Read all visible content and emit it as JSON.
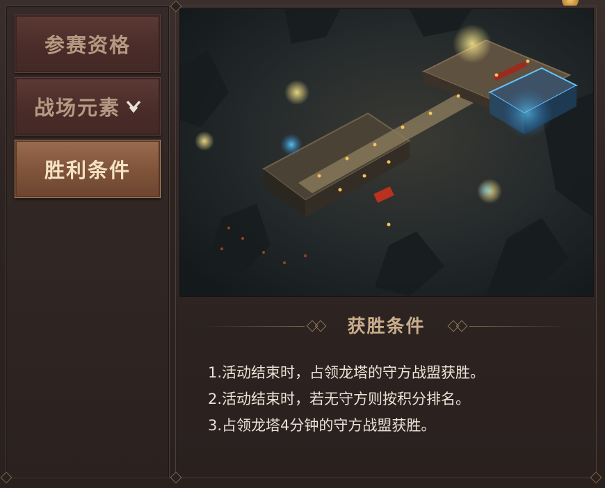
{
  "sidebar": {
    "tabs": [
      {
        "label": "参赛资格",
        "state": "inactive"
      },
      {
        "label": "战场元素",
        "state": "inactive",
        "icon": "chevron-down-double-icon"
      },
      {
        "label": "胜利条件",
        "state": "active"
      }
    ]
  },
  "content": {
    "map_image": "dungeon-castle-battlefield-map",
    "heading": "获胜条件",
    "rules": [
      "1.活动结束时，占领龙塔的守方战盟获胜。",
      "2.活动结束时，若无守方则按积分排名。",
      "3.占领龙塔4分钟的守方战盟获胜。"
    ]
  },
  "colors": {
    "active_tab": "#8a5d42",
    "inactive_tab": "#4a2c29",
    "heading_text": "#c9ad8c",
    "body_text": "#ece2d6"
  }
}
